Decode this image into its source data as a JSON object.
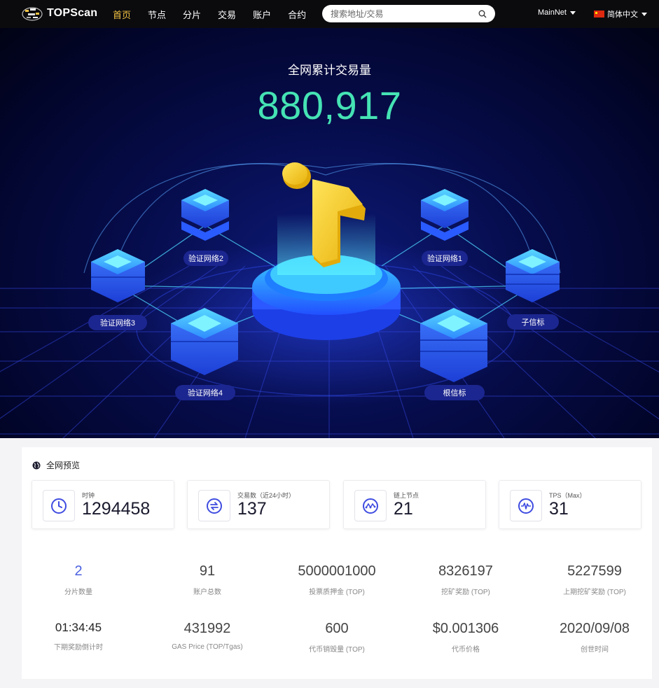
{
  "header": {
    "logo_text": "TOPScan",
    "nav": [
      "首页",
      "节点",
      "分片",
      "交易",
      "账户",
      "合约"
    ],
    "search_placeholder": "搜索地址/交易",
    "network": "MainNet",
    "language": "简体中文"
  },
  "hero": {
    "title": "全网累计交易量",
    "count": "880,917",
    "labels": {
      "validator2": "验证网络2",
      "validator1": "验证网络1",
      "validator3": "验证网络3",
      "child_beacon": "子信标",
      "validator4": "验证网络4",
      "root_beacon": "根信标"
    }
  },
  "overview": {
    "title": "全网预览",
    "cards": [
      {
        "label": "时钟",
        "value": "1294458",
        "icon": "clock-icon"
      },
      {
        "label": "交易数（近24小时）",
        "value": "137",
        "icon": "exchange-icon"
      },
      {
        "label": "链上节点",
        "value": "21",
        "icon": "nodes-icon"
      },
      {
        "label": "TPS（Max）",
        "value": "31",
        "icon": "pulse-icon"
      }
    ],
    "row1": [
      {
        "value": "2",
        "label": "分片数量"
      },
      {
        "value": "91",
        "label": "账户总数"
      },
      {
        "value": "5000001000",
        "label": "投票质押金 (TOP)"
      },
      {
        "value": "8326197",
        "label": "挖矿奖励 (TOP)"
      },
      {
        "value": "5227599",
        "label": "上期挖矿奖励 (TOP)"
      }
    ],
    "row2": [
      {
        "value": "01:34:45",
        "label": "下期奖励倒计时"
      },
      {
        "value": "431992",
        "label": "GAS Price (TOP/Tgas)"
      },
      {
        "value": "600",
        "label": "代币销毁量 (TOP)"
      },
      {
        "value": "$0.001306",
        "label": "代币价格"
      },
      {
        "value": "2020/09/08",
        "label": "创世时间"
      }
    ]
  },
  "colors": {
    "accent_nav": "#f5c542",
    "count_green": "#45e3b4",
    "stat_blue": "#4c61e0"
  }
}
